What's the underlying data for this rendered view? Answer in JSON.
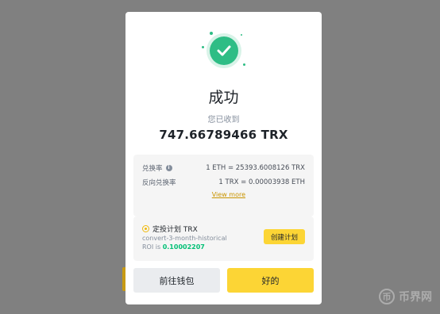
{
  "background": {
    "watermark": "币界网",
    "watermark_icon": "币"
  },
  "success_icon": "check-icon",
  "modal": {
    "title": "成功",
    "subtitle": "您已收到",
    "amount": "747.66789466 TRX"
  },
  "rates": {
    "rate_label": "兑换率",
    "rate_value": "1 ETH = 25393.6008126 TRX",
    "inverse_label": "反向兑换率",
    "inverse_value": "1 TRX = 0.00003938 ETH",
    "view_more": "View more"
  },
  "plan": {
    "title": "定投计划 TRX",
    "name": "convert-3-month-historical",
    "roi_label": "ROI is",
    "roi_value": "0.10002207",
    "create_button": "创建计划"
  },
  "buttons": {
    "wallet": "前往钱包",
    "ok": "好的"
  },
  "colors": {
    "accent": "#fcd535",
    "success": "#2ebd85",
    "overlay": "#808080"
  }
}
